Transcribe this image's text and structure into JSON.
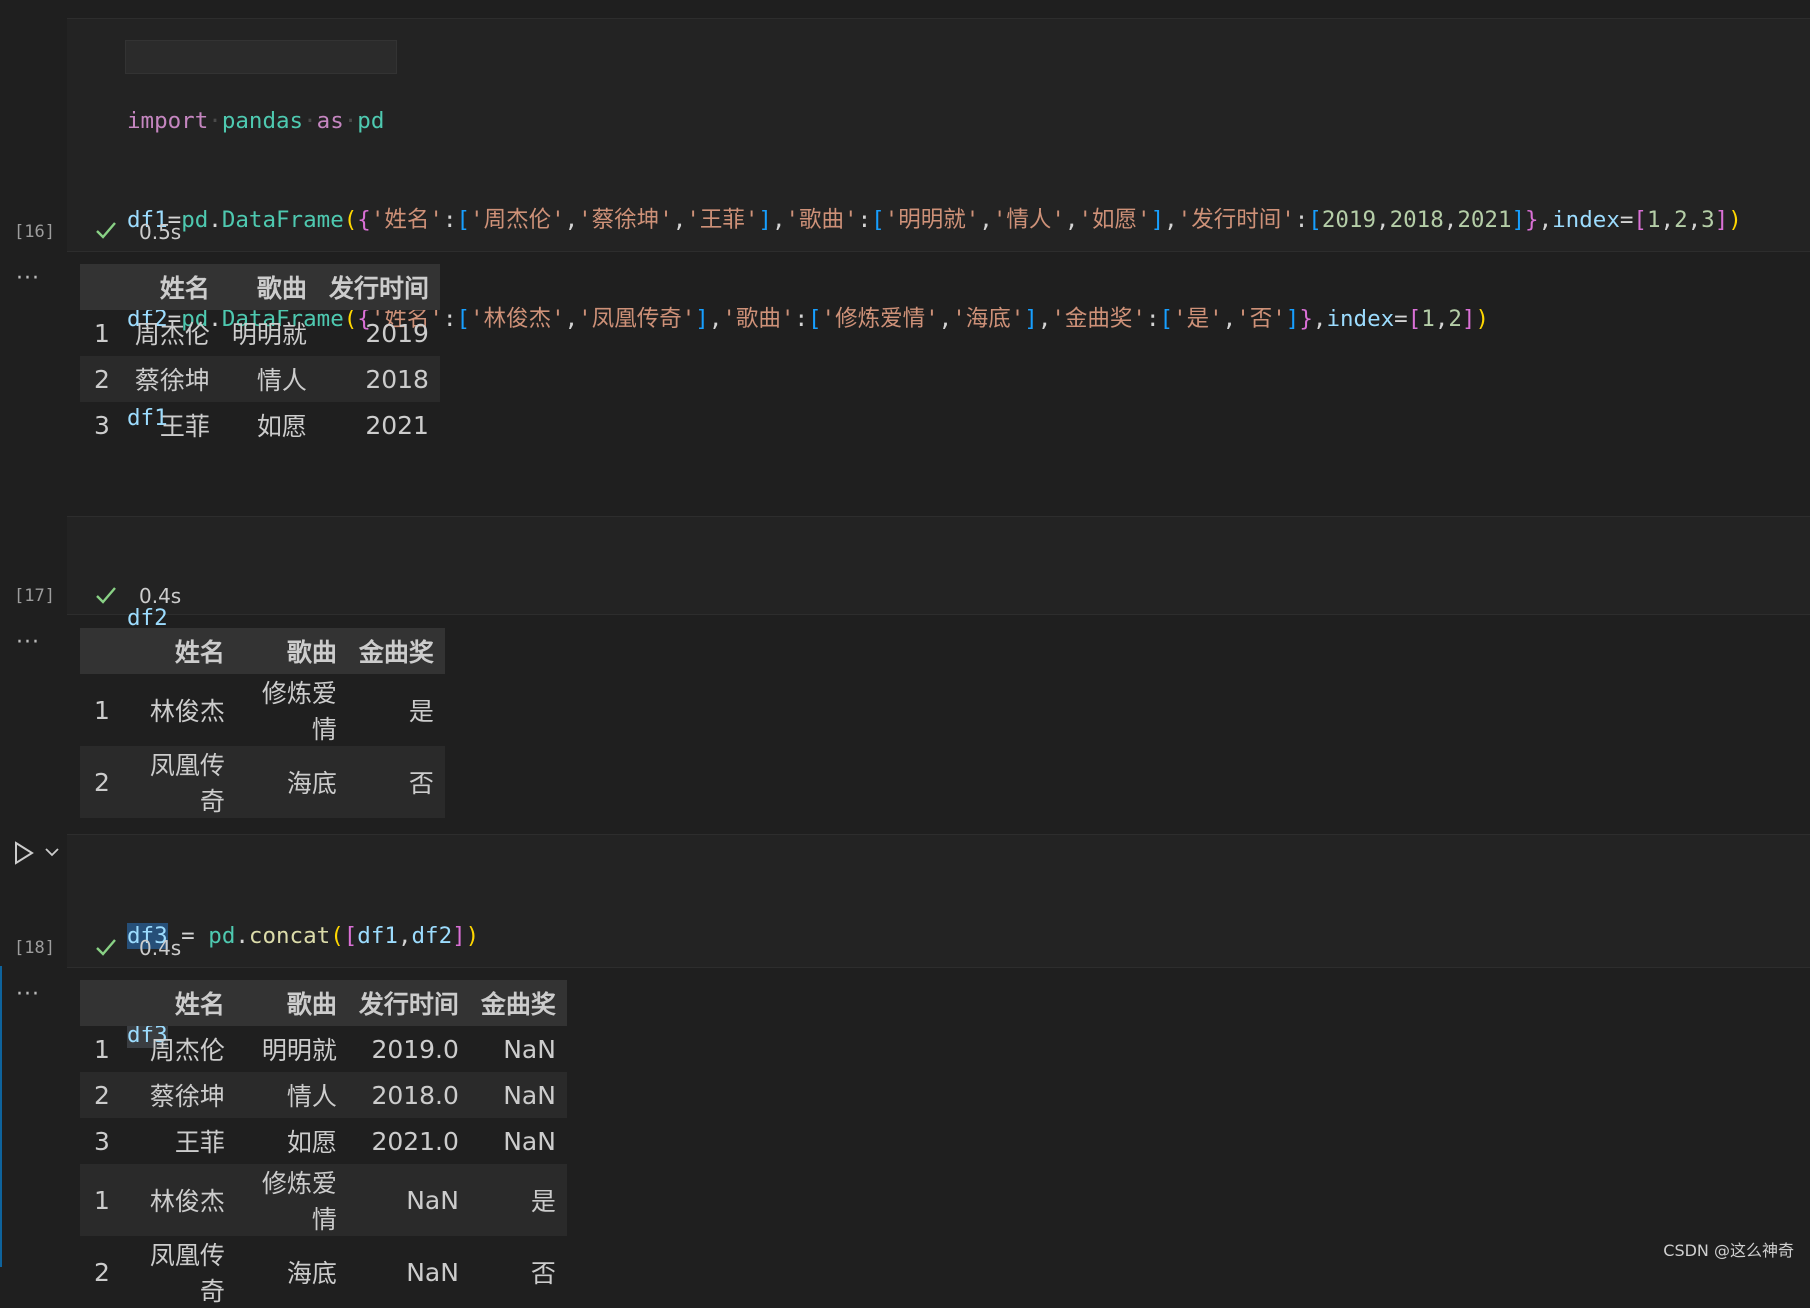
{
  "cells": [
    {
      "exec_count": "[16]",
      "duration": "0.5s",
      "code_lines": [
        "import pandas as pd",
        "df1=pd.DataFrame({'姓名':['周杰伦','蔡徐坤','王菲'],'歌曲':['明明就','情人','如愿'],'发行时间':[2019,2018,2021]},index=[1,2,3])",
        "df2=pd.DataFrame({'姓名':['林俊杰','凤凰传奇'],'歌曲':['修炼爱情','海底'],'金曲奖':['是','否']},index=[1,2])",
        "df1"
      ],
      "output_table": {
        "columns": [
          "",
          "姓名",
          "歌曲",
          "发行时间"
        ],
        "rows": [
          [
            "1",
            "周杰伦",
            "明明就",
            "2019"
          ],
          [
            "2",
            "蔡徐坤",
            "情人",
            "2018"
          ],
          [
            "3",
            "王菲",
            "如愿",
            "2021"
          ]
        ]
      }
    },
    {
      "exec_count": "[17]",
      "duration": "0.4s",
      "code_lines": [
        "df2"
      ],
      "output_table": {
        "columns": [
          "",
          "姓名",
          "歌曲",
          "金曲奖"
        ],
        "rows": [
          [
            "1",
            "林俊杰",
            "修炼爱情",
            "是"
          ],
          [
            "2",
            "凤凰传奇",
            "海底",
            "否"
          ]
        ]
      }
    },
    {
      "exec_count": "[18]",
      "duration": "0.4s",
      "code_lines": [
        "df3 = pd.concat([df1,df2])",
        "df3"
      ],
      "output_table": {
        "columns": [
          "",
          "姓名",
          "歌曲",
          "发行时间",
          "金曲奖"
        ],
        "rows": [
          [
            "1",
            "周杰伦",
            "明明就",
            "2019.0",
            "NaN"
          ],
          [
            "2",
            "蔡徐坤",
            "情人",
            "2018.0",
            "NaN"
          ],
          [
            "3",
            "王菲",
            "如愿",
            "2021.0",
            "NaN"
          ],
          [
            "1",
            "林俊杰",
            "修炼爱情",
            "NaN",
            "是"
          ],
          [
            "2",
            "凤凰传奇",
            "海底",
            "NaN",
            "否"
          ]
        ]
      }
    }
  ],
  "output_menu_glyph": "···",
  "watermark": "CSDN @这么神奇",
  "icons": {
    "success": "check-icon",
    "run": "run-cell-icon",
    "expand": "chevron-down-icon",
    "output_menu": "more-icon"
  },
  "colors": {
    "background": "#1f1f1f",
    "cell_background": "#232323",
    "success_check": "#89d185",
    "keyword": "#c586c0",
    "string": "#ce9178",
    "number": "#b5cea8",
    "variable": "#9cdcfe",
    "function": "#dcdcaa",
    "module": "#4ec9b0",
    "active_cell_bar": "#0e639c"
  }
}
